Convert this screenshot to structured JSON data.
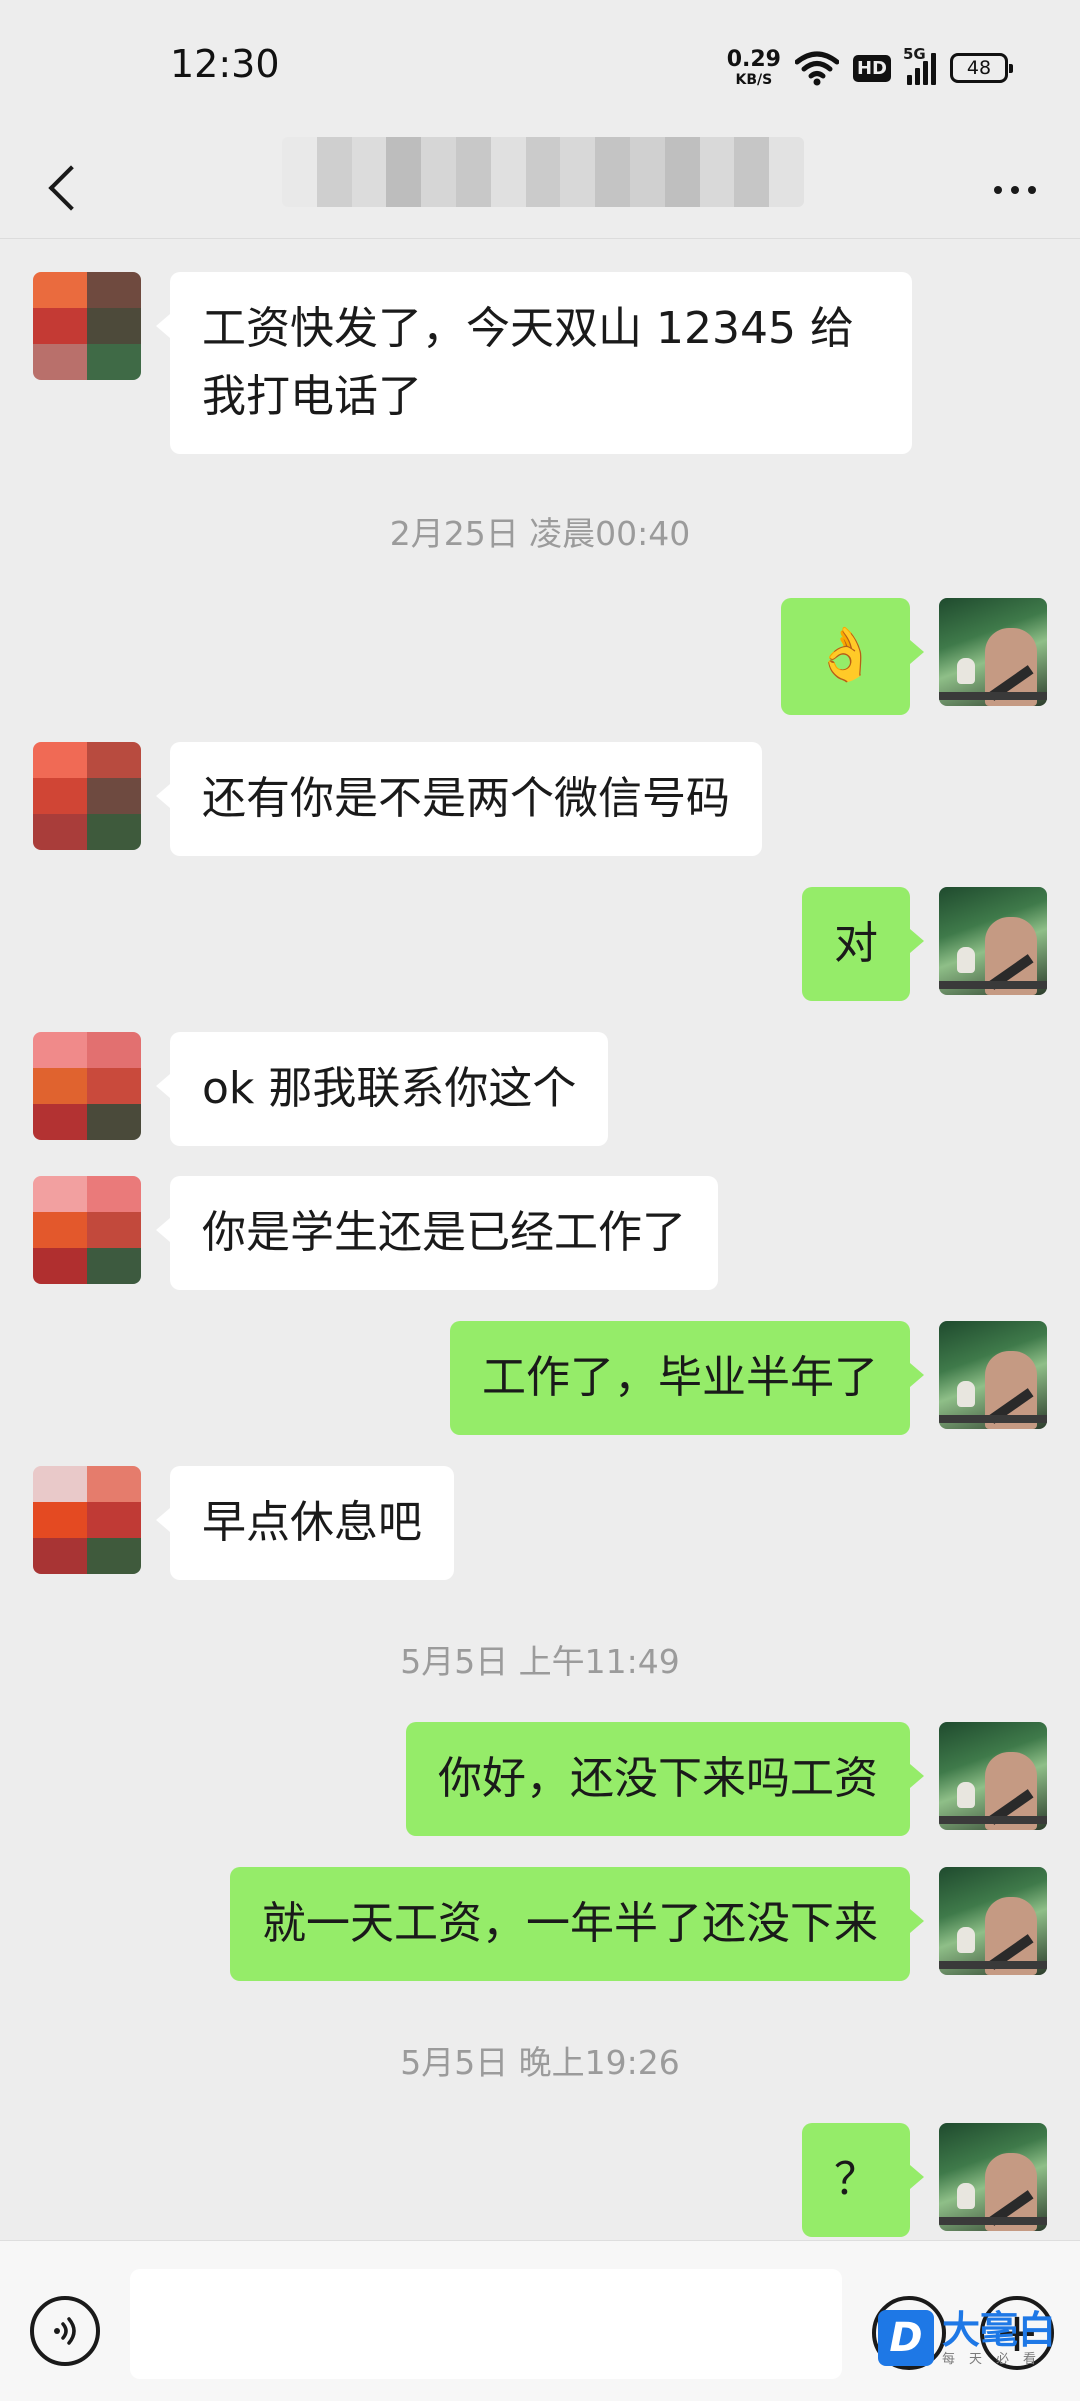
{
  "status_bar": {
    "time": "12:30",
    "net_speed_value": "0.29",
    "net_speed_unit": "KB/S",
    "hd_label": "HD",
    "signal_label": "5G",
    "battery": "48"
  },
  "nav": {
    "title": "",
    "back_icon": "chevron-left-icon",
    "more_icon": "more-dots-icon"
  },
  "messages": [
    {
      "side": "left",
      "text": "工资快发了，今天双山 12345 给我打电话了"
    },
    {
      "type": "timestamp",
      "text": "2月25日 凌晨00:40"
    },
    {
      "side": "right",
      "emoji": "👌"
    },
    {
      "side": "left",
      "text": "还有你是不是两个微信号码"
    },
    {
      "side": "right",
      "text": "对"
    },
    {
      "side": "left",
      "text": "ok 那我联系你这个"
    },
    {
      "side": "left",
      "text": "你是学生还是已经工作了"
    },
    {
      "side": "right",
      "text": "工作了，毕业半年了"
    },
    {
      "side": "left",
      "text": "早点休息吧"
    },
    {
      "type": "timestamp",
      "text": "5月5日 上午11:49"
    },
    {
      "side": "right",
      "text": "你好，还没下来吗工资"
    },
    {
      "side": "right",
      "text": "就一天工资，一年半了还没下来"
    },
    {
      "type": "timestamp",
      "text": "5月5日 晚上19:26"
    },
    {
      "side": "right",
      "text": "？"
    }
  ],
  "input_bar": {
    "placeholder": "",
    "voice_icon": "voice-icon",
    "emoji_icon": "emoji-icon",
    "plus_icon": "plus-icon"
  },
  "watermark": {
    "logo_letter": "D",
    "main": "大毫白",
    "sub": "每天必看"
  },
  "colors": {
    "background": "#ededed",
    "bubble_mine": "#95ec69",
    "bubble_theirs": "#ffffff",
    "timestamp": "#9b9b9b",
    "watermark": "#1e78e6"
  }
}
